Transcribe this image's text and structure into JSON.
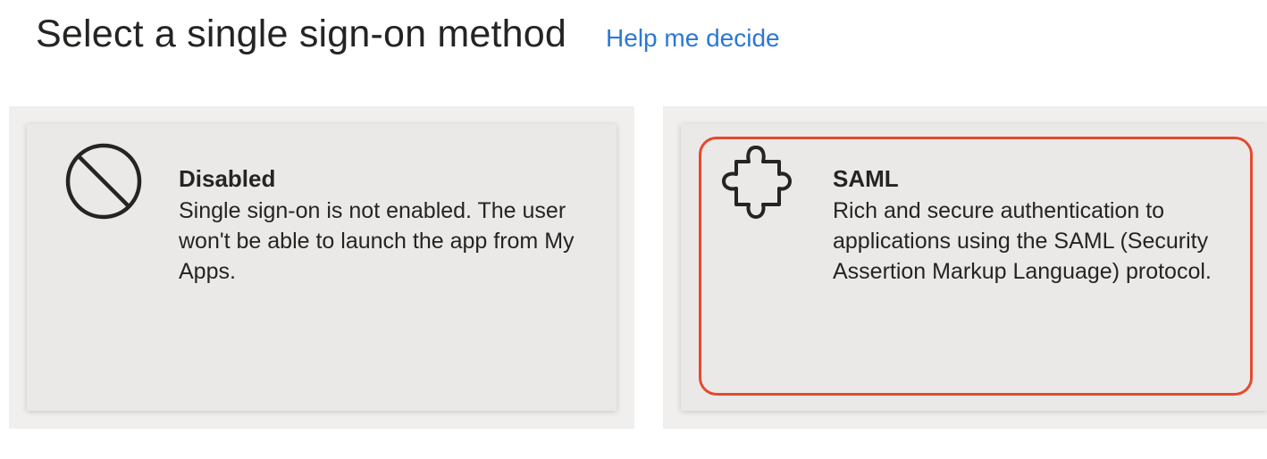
{
  "header": {
    "title": "Select a single sign-on method",
    "help_link": "Help me decide"
  },
  "tiles": [
    {
      "title": "Disabled",
      "description": "Single sign-on is not enabled. The user won't be able to launch the app from My Apps.",
      "icon": "disabled-icon",
      "selected": false
    },
    {
      "title": "SAML",
      "description": "Rich and secure authentication to applications using the SAML (Security Assertion Markup Language) protocol.",
      "icon": "puzzle-piece-icon",
      "selected": true
    }
  ],
  "colors": {
    "link": "#2b78d4",
    "selection_border": "#e5492d",
    "tile_background": "#ebe9e8",
    "text": "#252423"
  }
}
